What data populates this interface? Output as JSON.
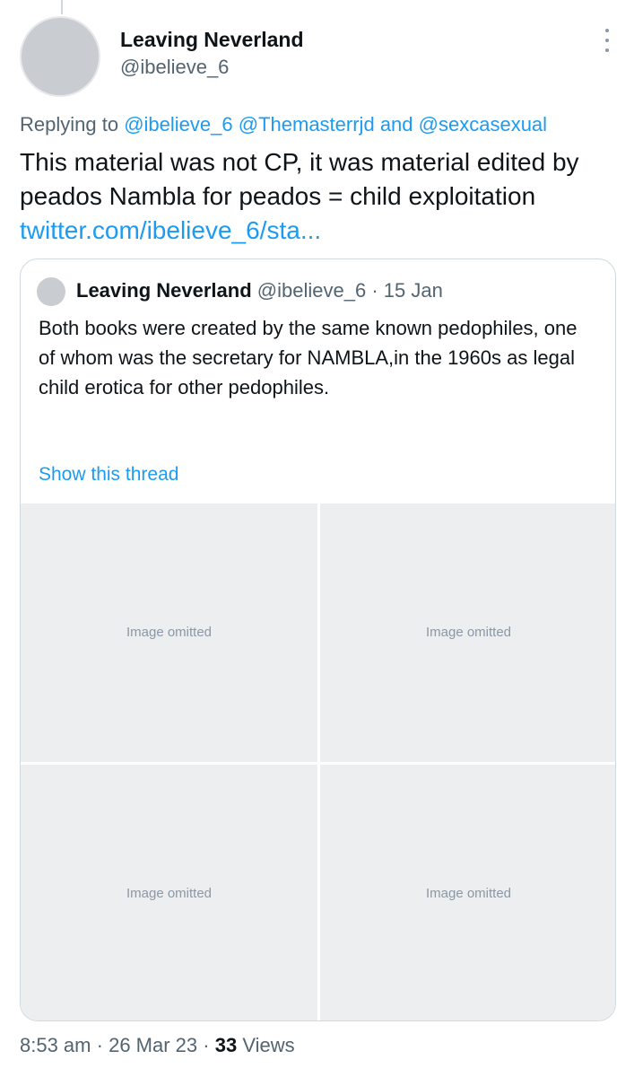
{
  "author": {
    "name": "Leaving Neverland",
    "handle": "@ibelieve_6"
  },
  "reply": {
    "prefix": "Replying to",
    "mention1": "@ibelieve_6",
    "mention2": "@Themasterrjd",
    "joiner": "and",
    "mention3": "@sexcasexual"
  },
  "tweet": {
    "text": "This material was not CP, it was material edited by peados Nambla for peados = child exploitation",
    "link": "twitter.com/ibelieve_6/sta..."
  },
  "quote": {
    "name": "Leaving Neverland",
    "handle": "@ibelieve_6",
    "separator": "·",
    "date": "15 Jan",
    "text": "Both books were created by the same known pedophiles, one of whom was the secretary for NAMBLA,in the 1960s as legal child erotica for other pedophiles.",
    "ellipsis": "...",
    "show_thread": "Show this thread",
    "media_placeholder": "Image omitted"
  },
  "footer": {
    "time": "8:53 am",
    "sep1": "·",
    "date": "26 Mar 23",
    "sep2": "·",
    "views_count": "33",
    "views_label": "Views"
  },
  "colors": {
    "link": "#1d9bf0",
    "secondary": "#536471",
    "primary": "#0f1419",
    "border": "#cfd9de"
  }
}
